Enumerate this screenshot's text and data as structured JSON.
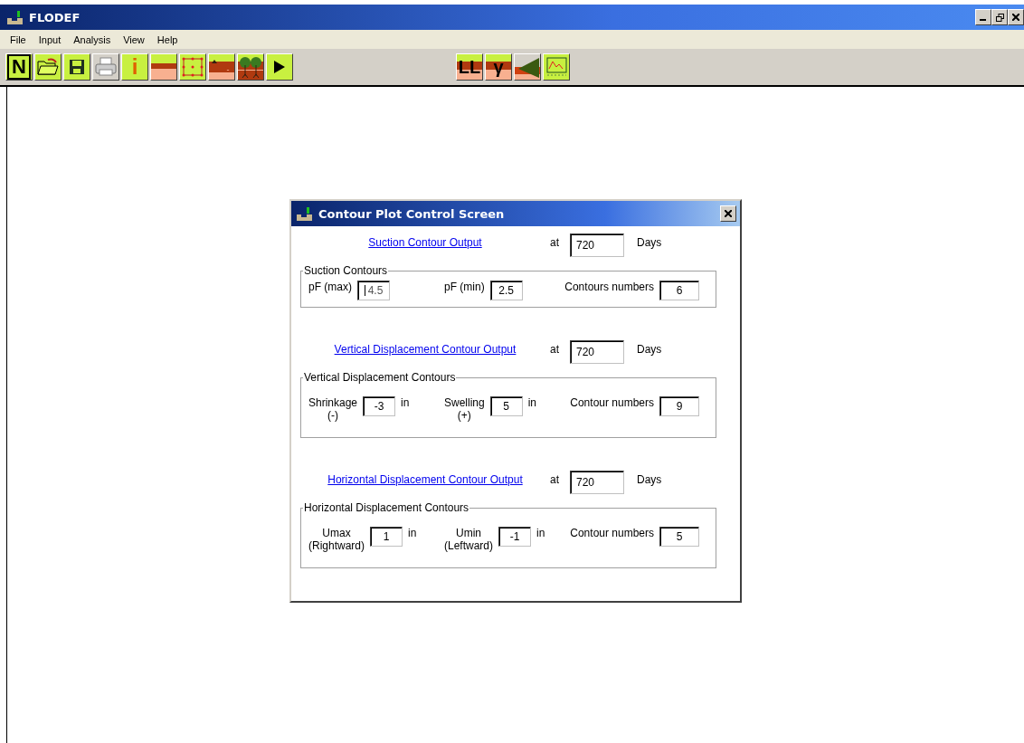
{
  "window": {
    "title": "FLODEF"
  },
  "menu": [
    "File",
    "Input",
    "Analysis",
    "View",
    "Help"
  ],
  "toolbar": [
    {
      "kind": "letter",
      "label": "N"
    },
    {
      "kind": "folder"
    },
    {
      "kind": "disk"
    },
    {
      "kind": "printer"
    },
    {
      "kind": "info",
      "label": "i"
    },
    {
      "kind": "layers"
    },
    {
      "kind": "mesh"
    },
    {
      "kind": "terrain"
    },
    {
      "kind": "trees"
    },
    {
      "kind": "play"
    }
  ],
  "toolbar2": [
    {
      "kind": "soil-letter",
      "label": "LL"
    },
    {
      "kind": "soil-letter",
      "label": "γ"
    },
    {
      "kind": "slope"
    },
    {
      "kind": "graph"
    }
  ],
  "dialog": {
    "title": "Contour Plot  Control Screen",
    "sections": [
      {
        "link": "Suction Contour Output",
        "at": "at",
        "days": "720",
        "days_label": "Days",
        "group": "Suction Contours",
        "fields": [
          {
            "label": "pF (max)",
            "value": "4.5",
            "focused": true
          },
          {
            "label": "pF (min)",
            "value": "2.5",
            "focused": false
          },
          {
            "label": "Contours numbers",
            "value": "6",
            "focused": false
          }
        ]
      },
      {
        "link": "Vertical Displacement Contour Output",
        "at": "at",
        "days": "720",
        "days_label": "Days",
        "group": "Vertical Displacement Contours",
        "fields": [
          {
            "label": "Shrinkage",
            "sublabel": "(-)",
            "value": "-3",
            "unit": "in",
            "focused": false
          },
          {
            "label": "Swelling",
            "sublabel": "(+)",
            "value": "5",
            "unit": "in",
            "focused": false
          },
          {
            "label": "Contour numbers",
            "value": "9",
            "focused": false
          }
        ]
      },
      {
        "link": "Horizontal Displacement Contour Output",
        "at": "at",
        "days": "720",
        "days_label": "Days",
        "group": "Horizontal Displacement Contours",
        "fields": [
          {
            "label": "Umax",
            "sublabel": "(Rightward)",
            "value": "1",
            "unit": "in",
            "focused": false
          },
          {
            "label": "Umin",
            "sublabel": "(Leftward)",
            "value": "-1",
            "unit": "in",
            "focused": false
          },
          {
            "label": "Contour numbers",
            "value": "5",
            "focused": false
          }
        ]
      }
    ]
  }
}
